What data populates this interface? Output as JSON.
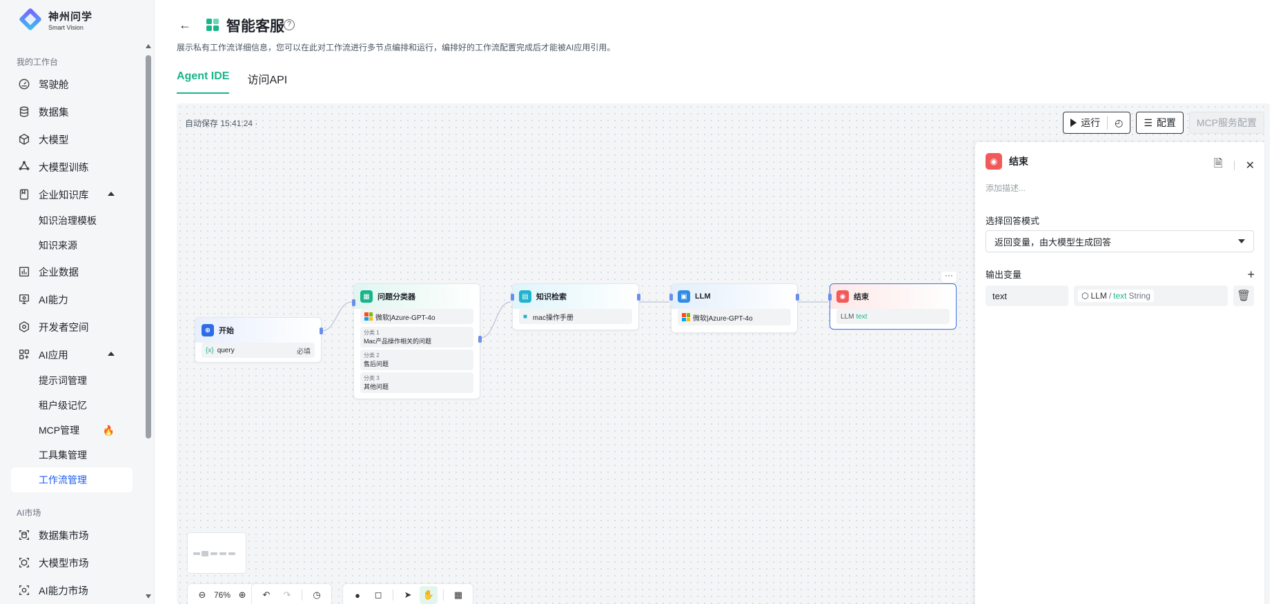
{
  "brand": {
    "name_cn": "神州问学",
    "name_en": "Smart Vision"
  },
  "sidebar": {
    "section_workbench": "我的工作台",
    "items": [
      {
        "label": "驾驶舱",
        "icon": "dashboard-icon"
      },
      {
        "label": "数据集",
        "icon": "database-icon"
      },
      {
        "label": "大模型",
        "icon": "cube-icon"
      },
      {
        "label": "大模型训练",
        "icon": "training-icon"
      },
      {
        "label": "企业知识库",
        "icon": "book-icon",
        "expanded": true,
        "children": [
          "知识治理模板",
          "知识来源"
        ]
      },
      {
        "label": "企业数据",
        "icon": "chart-icon"
      },
      {
        "label": "AI能力",
        "icon": "monitor-icon"
      },
      {
        "label": "开发者空间",
        "icon": "hexagon-icon"
      },
      {
        "label": "AI应用",
        "icon": "apps-icon",
        "expanded": true,
        "children": [
          "提示词管理",
          "租户级记忆",
          "MCP管理",
          "工具集管理",
          "工作流管理"
        ]
      }
    ],
    "section_market": "AI市场",
    "market_items": [
      "数据集市场",
      "大模型市场",
      "AI能力市场"
    ],
    "active": "工作流管理"
  },
  "header": {
    "title": "智能客服",
    "description": "展示私有工作流详细信息，您可以在此对工作流进行多节点编排和运行，编排好的工作流配置完成后才能被AI应用引用。",
    "tabs": [
      {
        "label": "Agent IDE",
        "active": true
      },
      {
        "label": "访问API",
        "active": false
      }
    ]
  },
  "canvas": {
    "autosave": "自动保存 15:41:24 ·",
    "run_label": "运行",
    "config_label": "配置",
    "mcp_label": "MCP服务配置",
    "zoom": "76%"
  },
  "nodes": {
    "start": {
      "title": "开始",
      "var": "query",
      "required": "必填"
    },
    "classifier": {
      "title": "问题分类器",
      "model": "微软|Azure-GPT-4o",
      "categories": [
        {
          "key": "分类 1",
          "value": "Mac产品操作相关的问题"
        },
        {
          "key": "分类 2",
          "value": "售后问题"
        },
        {
          "key": "分类 3",
          "value": "其他问题"
        }
      ]
    },
    "retrieval": {
      "title": "知识检索",
      "kb": "mac操作手册"
    },
    "llm": {
      "title": "LLM",
      "model": "微软|Azure-GPT-4o"
    },
    "end": {
      "title": "结束",
      "ref_prefix": "LLM",
      "ref_var": "text"
    }
  },
  "panel": {
    "title": "结束",
    "description_placeholder": "添加描述...",
    "mode_label": "选择回答模式",
    "mode_value": "返回变量，由大模型生成回答",
    "output_label": "输出变量",
    "var_name": "text",
    "ref_node": "LLM",
    "ref_sep": "/",
    "ref_var": "text",
    "ref_type": "String"
  },
  "colors": {
    "accent": "#19b48a",
    "active_nav": "#1d5ef2",
    "end_node": "#f25a5a",
    "start_node": "#2e6be6"
  }
}
